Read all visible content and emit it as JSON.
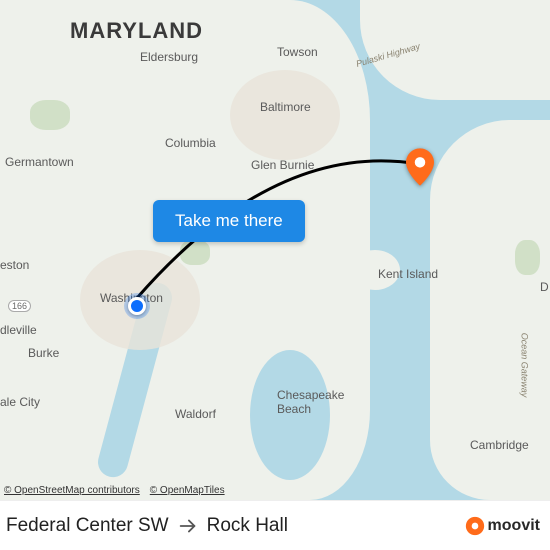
{
  "state_label": "MARYLAND",
  "cities": {
    "eldersburg": "Eldersburg",
    "towson": "Towson",
    "baltimore": "Baltimore",
    "columbia": "Columbia",
    "glen_burnie": "Glen Burnie",
    "germantown": "Germantown",
    "washington": "Washington",
    "eston": "eston",
    "dleville": "dleville",
    "burke": "Burke",
    "dale_city": "ale City",
    "waldorf": "Waldorf",
    "chesapeake_beach": "Chesapeake\nBeach",
    "kent_island": "Kent Island",
    "d": "D",
    "cambridge": "Cambridge"
  },
  "roads": {
    "pulaski": "Pulaski Highway",
    "ocean": "Ocean Gateway",
    "shield_166": "166"
  },
  "cta": "Take me there",
  "attribution": {
    "osm": "© OpenStreetMap contributors",
    "omt": "© OpenMapTiles"
  },
  "route": {
    "origin": "Federal Center SW",
    "destination": "Rock Hall"
  },
  "brand": "moovit",
  "colors": {
    "origin_pin": "#0d6efd",
    "dest_pin": "#ff6b1a",
    "cta_bg": "#1e88e5"
  }
}
